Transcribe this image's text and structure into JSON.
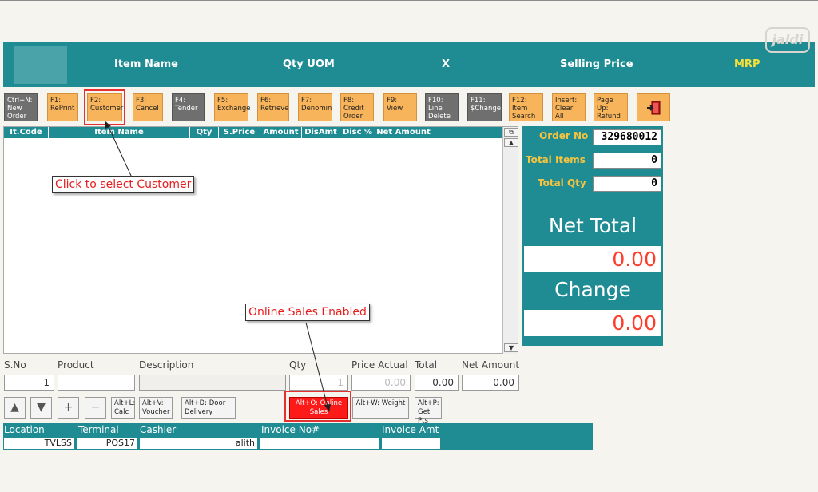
{
  "header": {
    "columns": [
      "Item Name",
      "Qty UOM",
      "X",
      "Selling Price",
      "MRP"
    ],
    "watermark": "jaldi"
  },
  "toolbar": [
    {
      "label": "Ctrl+N: New Order",
      "style": "gray"
    },
    {
      "label": "F1: RePrint",
      "style": "orange"
    },
    {
      "label": "F2: Customer",
      "style": "orange"
    },
    {
      "label": "F3: Cancel",
      "style": "orange"
    },
    {
      "label": "F4: Tender",
      "style": "gray"
    },
    {
      "label": "F5: Exchange",
      "style": "orange"
    },
    {
      "label": "F6: Retrieve",
      "style": "orange"
    },
    {
      "label": "F7: Denomin",
      "style": "orange"
    },
    {
      "label": "F8: Credit Order",
      "style": "orange"
    },
    {
      "label": "F9: View",
      "style": "orange"
    },
    {
      "label": "F10: Line Delete",
      "style": "gray"
    },
    {
      "label": "F11: $Change",
      "style": "gray"
    },
    {
      "label": "F12: Item Search",
      "style": "orange"
    },
    {
      "label": "Insert: Clear All",
      "style": "orange"
    },
    {
      "label": "Page Up: Refund",
      "style": "orange"
    }
  ],
  "grid": {
    "columns": [
      "It.Code",
      "Item Name",
      "Qty",
      "S.Price",
      "Amount",
      "DisAmt",
      "Disc %",
      "Net Amount"
    ]
  },
  "summary": {
    "order_no_label": "Order No",
    "order_no": "329680012",
    "total_items_label": "Total Items",
    "total_items": "0",
    "total_qty_label": "Total Qty",
    "total_qty": "0",
    "net_total_label": "Net Total",
    "net_total": "0.00",
    "change_label": "Change",
    "change": "0.00"
  },
  "entry": {
    "labels": [
      "S.No",
      "Product",
      "Description",
      "Qty",
      "Price Actual",
      "Total",
      "Net Amount"
    ],
    "sno": "1",
    "product": "",
    "description": "",
    "qty": "1",
    "price_actual": "0.00",
    "total": "0.00",
    "net_amount": "0.00"
  },
  "actions": {
    "calc": "Alt+L: Calc",
    "voucher": "Alt+V: Voucher",
    "door_delivery": "Alt+D: Door Delivery",
    "online_sales": "Alt+O: Online Sales",
    "weight": "Alt+W: Weight",
    "get_pts": "Alt+P: Get Pts"
  },
  "footer": {
    "location_label": "Location",
    "location": "TVLSS",
    "terminal_label": "Terminal",
    "terminal": "POS17",
    "cashier_label": "Cashier",
    "cashier": "alith",
    "invoice_no_label": "Invoice No#",
    "invoice_no": "",
    "invoice_amt_label": "Invoice Amt",
    "invoice_amt": ""
  },
  "callouts": {
    "customer": "Click to select Customer",
    "online": "Online Sales Enabled"
  },
  "colors": {
    "teal": "#1f8c93",
    "orange": "#f7b45a",
    "red": "#ff1a1a",
    "mrp": "#f5e13a"
  }
}
